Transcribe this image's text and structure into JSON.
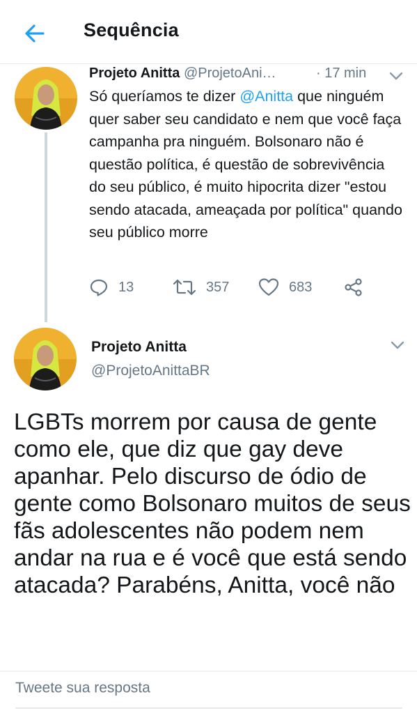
{
  "header": {
    "title": "Sequência",
    "back_icon": "arrow-left-icon",
    "accent": "#1da1f2"
  },
  "tweet1": {
    "name": "Projeto Anitta",
    "handle": "@ProjetoAni…",
    "time": "· 17 min",
    "text_before": "Só queríamos te dizer ",
    "mention": "@Anitta",
    "text_after": " que ninguém quer saber seu candidato e nem que você faça campanha pra ninguém. Bolsonaro não é questão política, é questão de sobrevivência do seu público, é muito hipocrita dizer \"estou sendo atacada, ameaçada por política\" quando seu público morre",
    "replies": "13",
    "retweets": "357",
    "likes": "683"
  },
  "tweet2": {
    "name": "Projeto Anitta",
    "handle": "@ProjetoAnittaBR",
    "text": "LGBTs morrem por causa de gente como ele, que diz que gay deve apanhar. Pelo discurso de ódio de gente como Bolsonaro muitos de seus fãs adolescentes não podem nem andar na rua e é você que está sendo atacada? Parabéns, Anitta, você não"
  },
  "reply": {
    "placeholder": "Tweete sua resposta"
  },
  "colors": {
    "text": "#14171a",
    "secondary": "#657786",
    "divider": "#e1e8ed",
    "avatar_bg": "#e3a020"
  }
}
